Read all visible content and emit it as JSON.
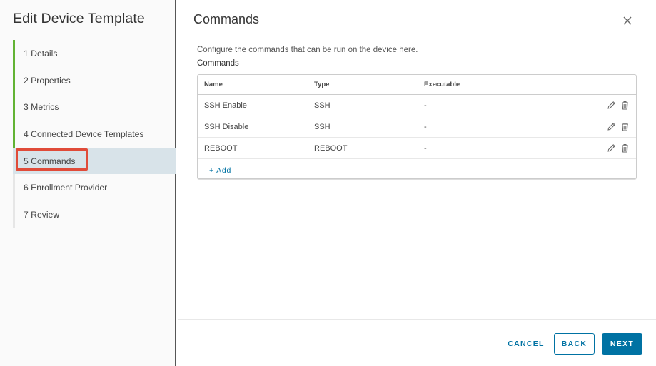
{
  "sidebar": {
    "title": "Edit Device Template",
    "steps": [
      {
        "label": "1 Details",
        "state": "done"
      },
      {
        "label": "2 Properties",
        "state": "done"
      },
      {
        "label": "3 Metrics",
        "state": "done"
      },
      {
        "label": "4 Connected Device Templates",
        "state": "done"
      },
      {
        "label": "5 Commands",
        "state": "active"
      },
      {
        "label": "6 Enrollment Provider",
        "state": "todo"
      },
      {
        "label": "7 Review",
        "state": "todo"
      }
    ]
  },
  "main": {
    "title": "Commands",
    "description": "Configure the commands that can be run on the device here.",
    "section_label": "Commands",
    "grid": {
      "columns": [
        "Name",
        "Type",
        "Executable"
      ],
      "rows": [
        {
          "name": "SSH Enable",
          "type": "SSH",
          "executable": "-"
        },
        {
          "name": "SSH Disable",
          "type": "SSH",
          "executable": "-"
        },
        {
          "name": "REBOOT",
          "type": "REBOOT",
          "executable": "-"
        }
      ],
      "add_label": "+ Add"
    }
  },
  "footer": {
    "cancel_label": "CANCEL",
    "back_label": "BACK",
    "next_label": "NEXT"
  },
  "colors": {
    "accent": "#0072a3",
    "done_rail": "#62b334",
    "active_step_bg": "#d8e3e9",
    "highlight": "#e04b39"
  },
  "icons": {
    "close": "close-icon",
    "edit": "pencil-icon",
    "delete": "trash-icon"
  }
}
